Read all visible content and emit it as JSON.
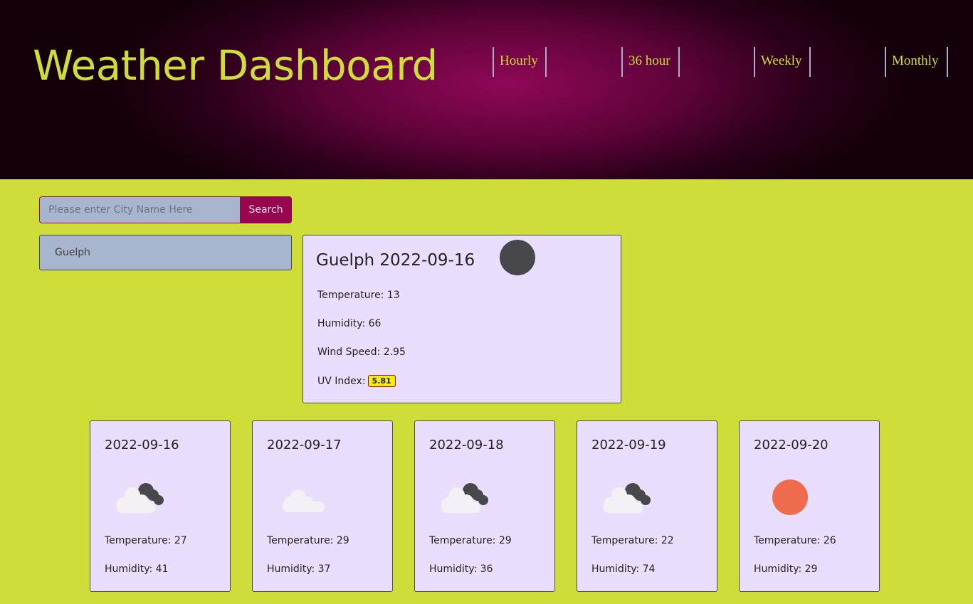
{
  "header": {
    "title": "Weather Dashboard",
    "nav": [
      "Hourly",
      "36 hour",
      "Weekly",
      "Monthly"
    ]
  },
  "search": {
    "placeholder": "Please enter City Name Here",
    "button_label": "Search"
  },
  "history": [
    "Guelph"
  ],
  "current": {
    "title": "Guelph 2022-09-16",
    "icon": "dark-circle-icon",
    "temperature": "Temperature: 13",
    "humidity": "Humidity: 66",
    "wind": "Wind Speed: 2.95",
    "uv_label": "UV Index:",
    "uv_value": "5.81"
  },
  "forecast": [
    {
      "date": "2022-09-16",
      "icon": "cloudy-icon",
      "temperature": "Temperature: 27",
      "humidity": "Humidity: 41"
    },
    {
      "date": "2022-09-17",
      "icon": "cloud-icon",
      "temperature": "Temperature: 29",
      "humidity": "Humidity: 37"
    },
    {
      "date": "2022-09-18",
      "icon": "cloudy-icon",
      "temperature": "Temperature: 29",
      "humidity": "Humidity: 36"
    },
    {
      "date": "2022-09-19",
      "icon": "cloudy-icon",
      "temperature": "Temperature: 22",
      "humidity": "Humidity: 74"
    },
    {
      "date": "2022-09-20",
      "icon": "sun-icon",
      "temperature": "Temperature: 26",
      "humidity": "Humidity: 29"
    }
  ],
  "colors": {
    "page_bg": "#cfdd39",
    "header_center": "#8f0856",
    "card_bg": "#e9dffc",
    "accent": "#98064f",
    "uv_badge": "#f7ee00",
    "sun": "#ee6b4d"
  }
}
